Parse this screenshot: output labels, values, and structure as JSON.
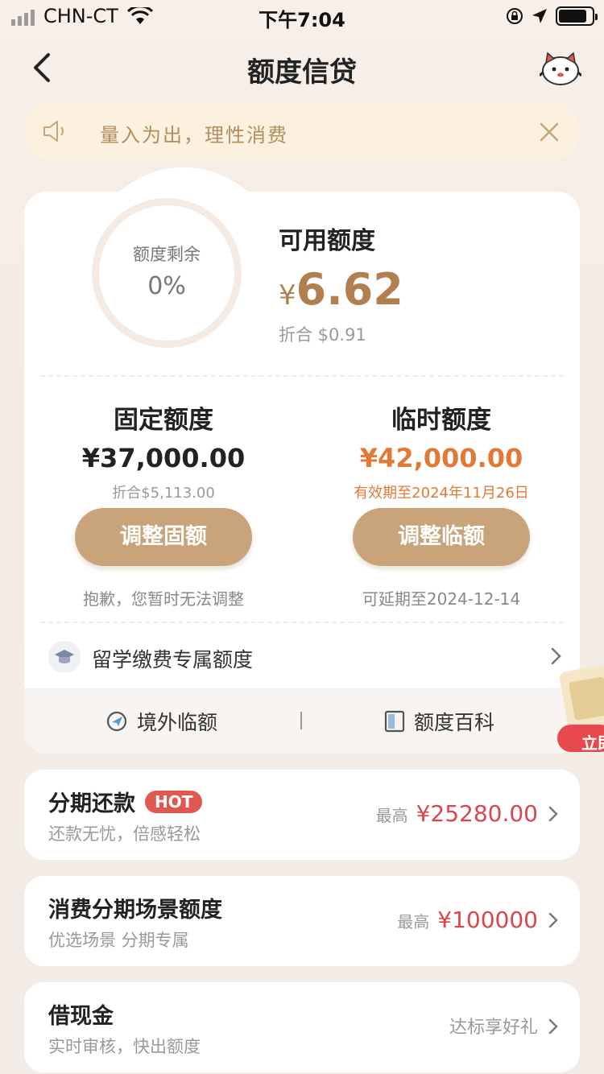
{
  "status_bar": {
    "carrier": "CHN-CT",
    "time": "下午7:04"
  },
  "nav": {
    "title": "额度信贷"
  },
  "notice": {
    "text": "量入为出，理性消费"
  },
  "summary": {
    "ring_label": "额度剩余",
    "ring_percent": "0%",
    "available_label": "可用额度",
    "currency_symbol": "¥",
    "available_amount": "6.62",
    "available_equiv": "折合  $0.91"
  },
  "fixed": {
    "title": "固定额度",
    "amount": "¥37,000.00",
    "equiv": "折合$5,113.00",
    "button": "调整固额",
    "note": "抱歉，您暂时无法调整"
  },
  "temporary": {
    "title": "临时额度",
    "amount": "¥42,000.00",
    "valid_until": "有效期至2024年11月26日",
    "button": "调整临额",
    "note": "可延期至2024-12-14"
  },
  "study": {
    "label": "留学缴费专属额度"
  },
  "bottom_links": {
    "overseas": "境外临额",
    "wiki": "额度百科"
  },
  "promo": {
    "label": "立即"
  },
  "installment": {
    "title": "分期还款",
    "badge": "HOT",
    "subtitle": "还款无忧，倍感轻松",
    "prefix": "最高",
    "value": "¥25280.00"
  },
  "consumer": {
    "title": "消费分期场景额度",
    "subtitle": "优选场景 分期专属",
    "prefix": "最高",
    "value": "¥100000"
  },
  "cash": {
    "title": "借现金",
    "subtitle": "实时审核，快出额度",
    "note": "达标享好礼"
  },
  "colors": {
    "accent_gold": "#c9a37a",
    "amount_orange": "#e27a37",
    "amount_red": "#d7474d",
    "badge_red": "#e05850"
  }
}
